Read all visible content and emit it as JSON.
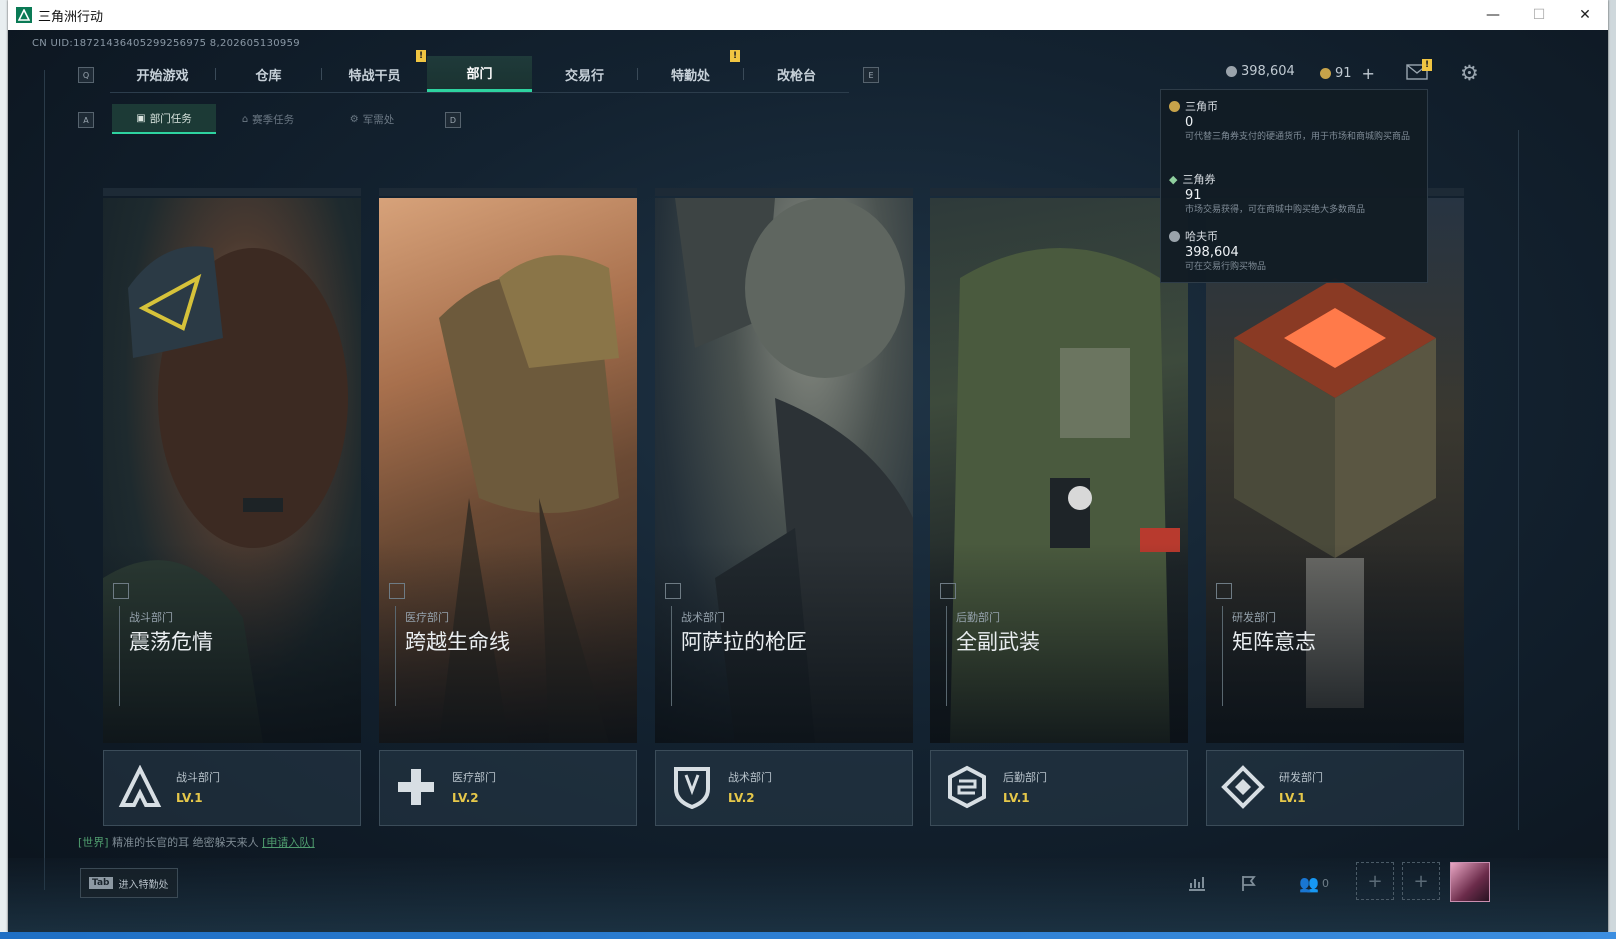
{
  "window": {
    "title": "三角洲行动",
    "minimize": "—",
    "maximize": "☐",
    "close": "✕"
  },
  "uid": "CN UID:18721436405299256975 8,202605130959",
  "nav": {
    "left_key": "Q",
    "right_key": "E",
    "tabs": [
      {
        "label": "开始游戏"
      },
      {
        "label": "仓库"
      },
      {
        "label": "特战干员",
        "alert": "!"
      },
      {
        "label": "部门",
        "active": true
      },
      {
        "label": "交易行"
      },
      {
        "label": "特勤处",
        "alert": "!"
      },
      {
        "label": "改枪台"
      }
    ]
  },
  "subnav": {
    "left_key": "A",
    "right_key": "D",
    "tabs": [
      {
        "label": "部门任务",
        "active": true
      },
      {
        "label": "赛季任务"
      },
      {
        "label": "军需处"
      }
    ]
  },
  "currency": {
    "hafcoin": "398,604",
    "triangle": "91",
    "add": "+",
    "mail_alert": "!"
  },
  "tooltip": {
    "items": [
      {
        "name": "三角币",
        "value": "0",
        "desc": "可代替三角券支付的硬通货币，用于市场和商城购买商品"
      },
      {
        "name": "三角券",
        "value": "91",
        "desc": "市场交易获得，可在商城中购买绝大多数商品"
      },
      {
        "name": "哈夫币",
        "value": "398,604",
        "desc": "可在交易行购买物品"
      }
    ]
  },
  "cards": [
    {
      "subtitle": "战斗部门",
      "title": "震荡危情",
      "dept": "战斗部门",
      "level": "LV.1"
    },
    {
      "subtitle": "医疗部门",
      "title": "跨越生命线",
      "dept": "医疗部门",
      "level": "LV.2"
    },
    {
      "subtitle": "战术部门",
      "title": "阿萨拉的枪匠",
      "dept": "战术部门",
      "level": "LV.2"
    },
    {
      "subtitle": "后勤部门",
      "title": "全副武装",
      "dept": "后勤部门",
      "level": "LV.1"
    },
    {
      "subtitle": "研发部门",
      "title": "矩阵意志",
      "dept": "研发部门",
      "level": "LV.1"
    }
  ],
  "chat": {
    "channel": "[世界]",
    "text": "精准的长官的耳 绝密躲天来人",
    "join": "[申请入队]"
  },
  "bottom": {
    "tab_key": "Tab",
    "tab_label": "进入特勤处",
    "friends_count": "0",
    "slot_add": "+"
  },
  "colors": {
    "accent": "#2ed3a0",
    "level": "#e6c84a",
    "alert": "#f0c542"
  }
}
